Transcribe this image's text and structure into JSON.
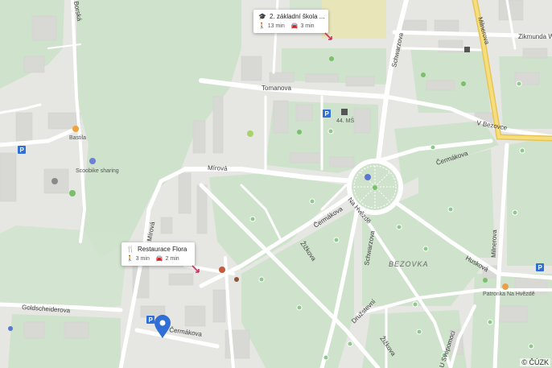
{
  "map": {
    "streets": {
      "tomanova": "Tomanova",
      "mirova": "Mírová",
      "schwarzova_top": "Schwarzova",
      "schwarzova_mid": "Schwarzova",
      "v_bezovce": "V Bezovce",
      "cermakova_ne": "Čermákova",
      "cermakova_mid": "Čermákova",
      "cermakova_sw": "Čermákova",
      "na_hvezde": "Na Hvězdě",
      "zizkova": "Žižkova",
      "zizkova_low": "Žižkova",
      "druzstevni": "Družstevní",
      "huskova": "Husková",
      "milnerova_right": "Milnerova",
      "milnerova_top": "Milnerova",
      "zikmunda": "Zikmunda W",
      "goldscheiderova": "Goldscheiderova",
      "mirova_vertical": "Mírová",
      "u_svepomoci": "U Svépomoci",
      "borska": "Borská"
    },
    "places": {
      "bastila": "Bastila",
      "scoobike": "Scoobike sharing",
      "ms44": "44. MŠ",
      "bezovka": "BEZOVKA",
      "patronka": "Patronka Na Hvězdě"
    },
    "copyright": "© ČÚZK"
  },
  "cards": [
    {
      "title": "2. základní škola ...",
      "walk": "13 min",
      "drive": "3 min",
      "icon": "school-icon"
    },
    {
      "title": "Restaurace Flora",
      "walk": "3 min",
      "drive": "2 min",
      "icon": "restaurant-icon"
    }
  ],
  "colors": {
    "park": "#cfe3cc",
    "street": "#ffffff",
    "main_road": "#f1d36a",
    "building": "#d8d8d4",
    "marker": "#2f6fd6",
    "background": "#e6e6e3"
  }
}
